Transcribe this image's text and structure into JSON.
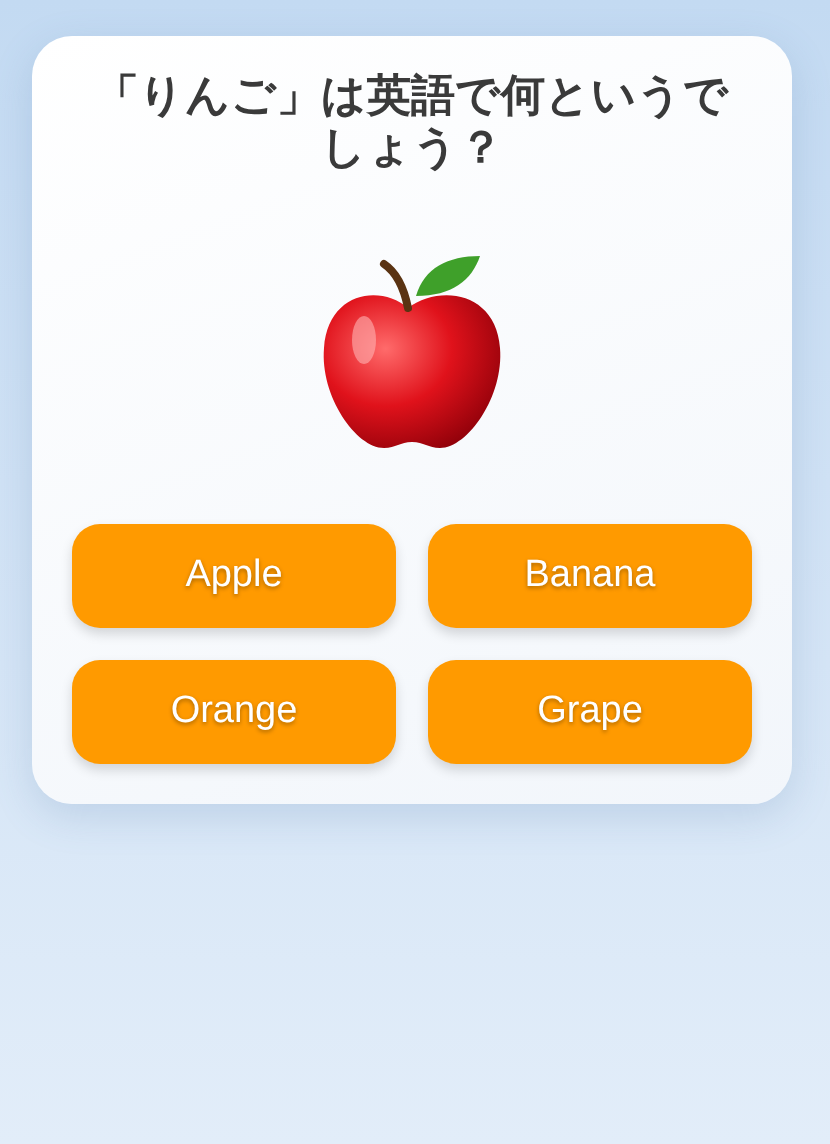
{
  "question": "「りんご」は英語で何というでしょう？",
  "options": [
    {
      "label": "Apple"
    },
    {
      "label": "Banana"
    },
    {
      "label": "Orange"
    },
    {
      "label": "Grape"
    }
  ]
}
